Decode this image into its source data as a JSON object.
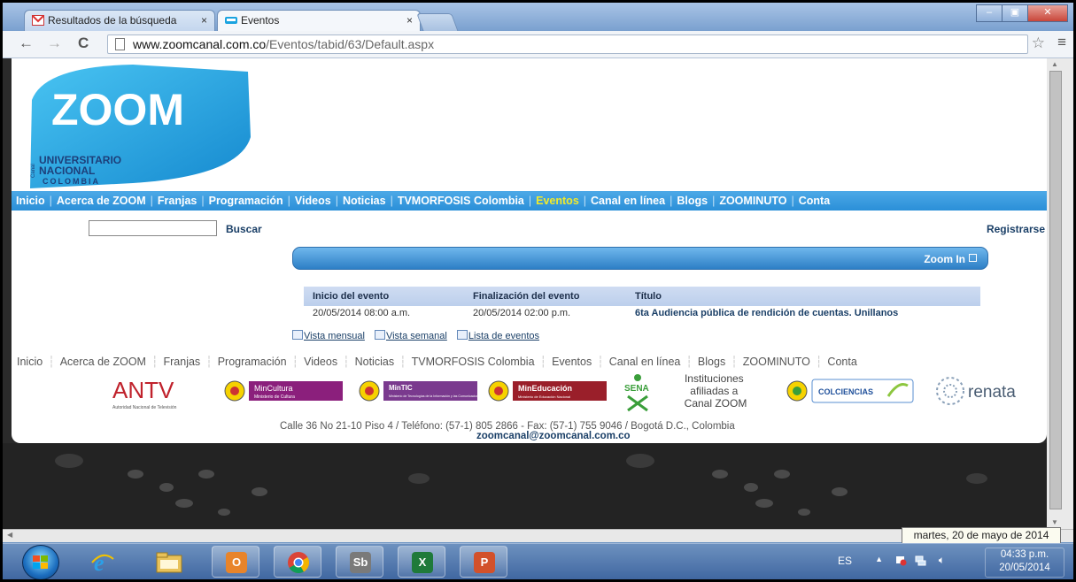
{
  "browser": {
    "tabs": [
      {
        "label": "Resultados de la búsqueda",
        "icon": "gmail-icon",
        "active": false
      },
      {
        "label": "Eventos",
        "icon": "zoom-favicon",
        "active": true
      }
    ],
    "tab_close": "×",
    "url_host": "www.zoomcanal.com.co",
    "url_path": "/Eventos/tabid/63/Default.aspx",
    "back": "←",
    "forward": "→",
    "reload": "C",
    "star": "☆",
    "menu": "≡",
    "window_buttons": [
      "–",
      "▣",
      "✕"
    ]
  },
  "site": {
    "logo": {
      "wordmark": "ZOOM",
      "line1": "UNIVERSITARIO",
      "line2": "NACIONAL",
      "line3": "COLOMBIA",
      "canal": "Canal"
    },
    "nav": [
      "Inicio",
      "Acerca de ZOOM",
      "Franjas",
      "Programación",
      "Videos",
      "Noticias",
      "TVMORFOSIS Colombia",
      "Eventos",
      "Canal en línea",
      "Blogs",
      "ZOOMINUTO",
      "Conta"
    ],
    "nav_current": "Eventos",
    "search_button": "Buscar",
    "register": "Registrarse",
    "zoom_in": "Zoom In"
  },
  "events": {
    "headers": [
      "Inicio del evento",
      "Finalización del evento",
      "Título"
    ],
    "rows": [
      {
        "start": "20/05/2014 08:00 a.m.",
        "end": "20/05/2014 02:00 p.m.",
        "title": "6ta Audiencia pública de rendición de cuentas. Unillanos"
      }
    ],
    "views": [
      "Vista mensual",
      "Vista semanal",
      "Lista de eventos"
    ]
  },
  "footer": {
    "nav": [
      "Inicio",
      "Acerca de ZOOM",
      "Franjas",
      "Programación",
      "Videos",
      "Noticias",
      "TVMORFOSIS Colombia",
      "Eventos",
      "Canal en línea",
      "Blogs",
      "ZOOMINUTO",
      "Conta"
    ],
    "antv": "ANTV",
    "antv_sub": "Autoridad Nacional de Televisión",
    "mincultura": "MinCultura",
    "mincultura_sub": "Ministerio de Cultura",
    "mintic": "MinTIC",
    "mintic_sub": "Ministerio de Tecnologías de la Información y las Comunicaciones",
    "mineducacion": "MinEducación",
    "mineducacion_sub": "Ministerio de Educación Nacional",
    "sena": "SENA",
    "instituciones": [
      "Instituciones",
      "afiliadas a",
      "Canal ZOOM"
    ],
    "colciencias": "COLCIENCIAS",
    "renata": "renata",
    "address": "Calle 36 No 21-10 Piso 4 / Teléfono: (57-1) 805 2866 - Fax: (57-1) 755 9046 / Bogotá D.C., Colombia",
    "email": "zoomcanal@zoomcanal.com.co"
  },
  "tooltip": "martes, 20 de mayo de 2014",
  "taskbar": {
    "apps": [
      "ie-icon",
      "file-explorer-icon",
      "outlook-icon",
      "chrome-icon",
      "sb-icon",
      "excel-icon",
      "powerpoint-icon"
    ],
    "sb_label": "Sb",
    "language": "ES",
    "time": "04:33 p.m.",
    "date": "20/05/2014"
  },
  "colors": {
    "nav_bar": "#2a8fd8",
    "nav_current": "#f2ea2a",
    "link": "#1a3f67",
    "logo_blue": "#1aa3e0"
  }
}
